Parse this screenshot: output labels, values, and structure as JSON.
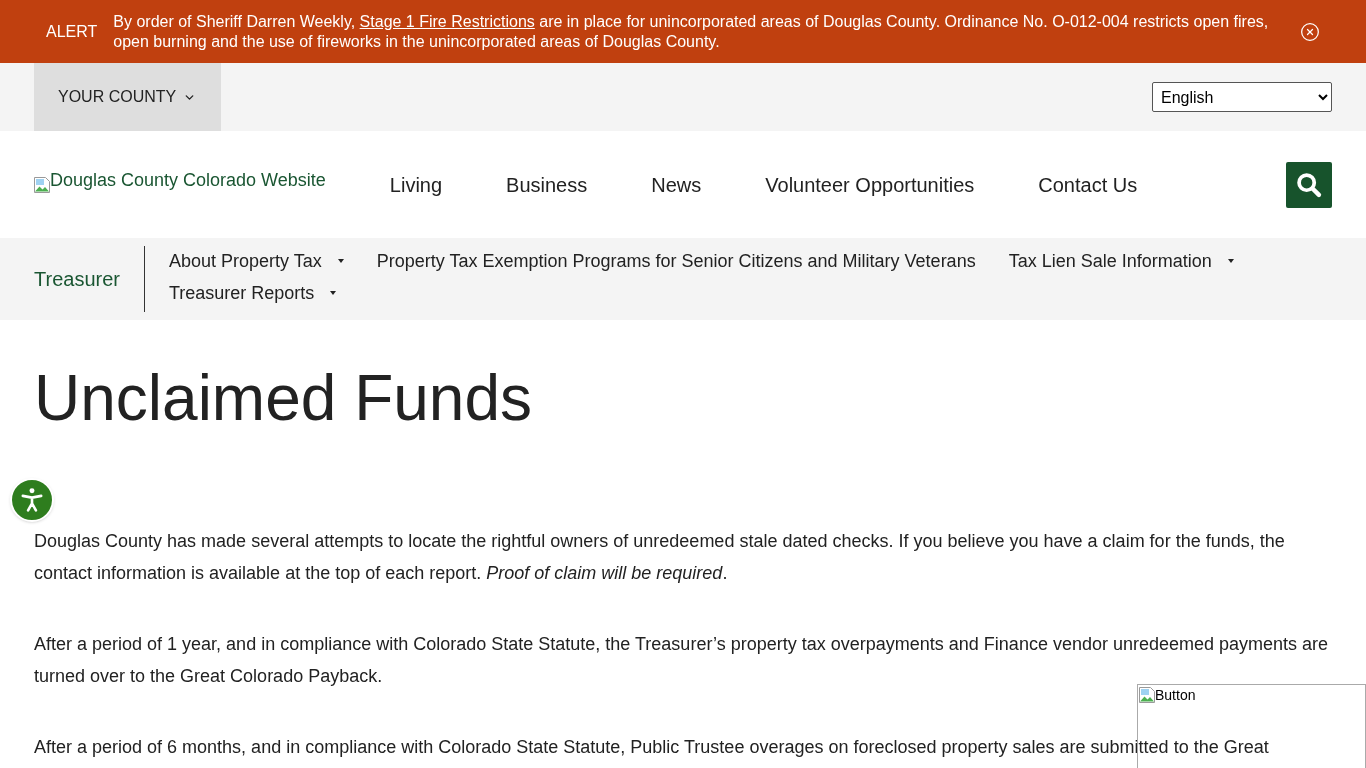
{
  "alert": {
    "label": "ALERT",
    "message": {
      "before": "By order of Sheriff Darren Weekly, ",
      "link": "Stage 1 Fire Restrictions",
      "after": " are in place for unincorporated areas of Douglas County. Ordinance No. O-012-004 restricts open fires, open burning and the use of fireworks in the unincorporated areas of Douglas County."
    }
  },
  "utility_bar": {
    "county_menu": "YOUR COUNTY",
    "language": "English"
  },
  "header": {
    "logo_alt": "Douglas County Colorado Website",
    "nav": [
      {
        "label": "Living"
      },
      {
        "label": "Business"
      },
      {
        "label": "News"
      },
      {
        "label": "Volunteer Opportunities"
      },
      {
        "label": "Contact Us"
      }
    ]
  },
  "section_nav": {
    "title": "Treasurer",
    "items": [
      {
        "label": "About Property Tax",
        "has_submenu": true
      },
      {
        "label": "Property Tax Exemption Programs for Senior Citizens and Military Veterans",
        "has_submenu": false
      },
      {
        "label": "Tax Lien Sale Information",
        "has_submenu": true
      },
      {
        "label": "Treasurer Reports",
        "has_submenu": true
      }
    ]
  },
  "page": {
    "title": "Unclaimed Funds",
    "paragraphs": [
      "Douglas County has made several attempts to locate the rightful owners of unredeemed stale dated checks. If you believe you have a claim for the funds, the contact information is available at the top of each report. *Proof of claim will be required*.",
      "After a period of 1 year, and in compliance with Colorado State Statute, the Treasurer’s property tax overpayments and Finance vendor unredeemed payments are turned over to the Great Colorado Payback.",
      "After a period of 6 months, and in compliance with Colorado State Statute, Public Trustee overages on foreclosed property sales are submitted to the Great"
    ]
  },
  "image_button": {
    "alt": "Button"
  }
}
